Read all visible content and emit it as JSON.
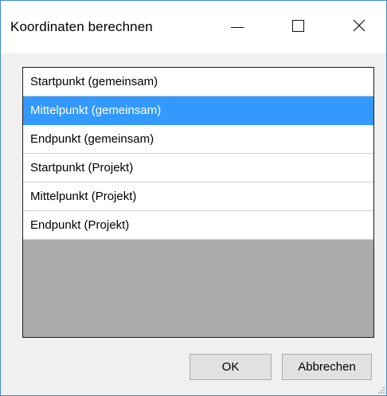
{
  "window": {
    "title": "Koordinaten berechnen"
  },
  "titlebar": {
    "minimize_icon": "minimize-icon",
    "maximize_icon": "maximize-icon",
    "close_icon": "close-icon"
  },
  "list": {
    "items": [
      {
        "label": "Startpunkt (gemeinsam)",
        "selected": false
      },
      {
        "label": "Mittelpunkt (gemeinsam)",
        "selected": true
      },
      {
        "label": "Endpunkt (gemeinsam)",
        "selected": false
      },
      {
        "label": "Startpunkt (Projekt)",
        "selected": false
      },
      {
        "label": "Mittelpunkt (Projekt)",
        "selected": false
      },
      {
        "label": "Endpunkt (Projekt)",
        "selected": false
      }
    ]
  },
  "buttons": {
    "ok_label": "OK",
    "cancel_label": "Abbrechen"
  },
  "colors": {
    "selection": "#3399ff",
    "window_border": "#3c8ad8",
    "list_empty_area": "#ababab"
  }
}
